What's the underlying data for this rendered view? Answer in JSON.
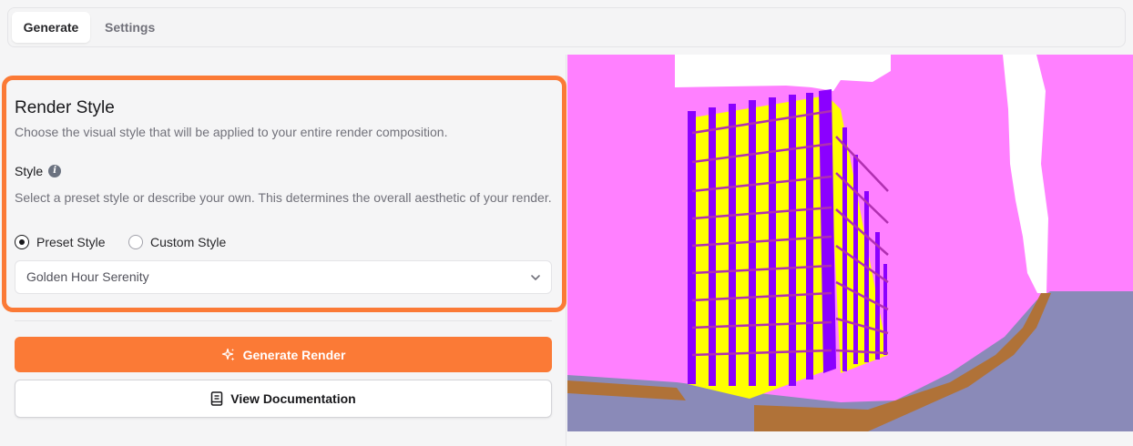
{
  "tabs": [
    {
      "label": "Generate",
      "active": true
    },
    {
      "label": "Settings",
      "active": false
    }
  ],
  "render_style": {
    "title": "Render Style",
    "description": "Choose the visual style that will be applied to your entire render composition.",
    "style_field": {
      "label": "Style",
      "help": "Select a preset style or describe your own. This determines the overall aesthetic of your render.",
      "options": [
        {
          "label": "Preset Style",
          "checked": true
        },
        {
          "label": "Custom Style",
          "checked": false
        }
      ],
      "selected_preset": "Golden Hour Serenity"
    }
  },
  "actions": {
    "generate_label": "Generate Render",
    "docs_label": "View Documentation"
  },
  "colors": {
    "accent": "#fb7a36",
    "seg_sky": "#ffffff",
    "seg_background": "#ff80ff",
    "seg_building_main": "#ffff00",
    "seg_building_frame": "#8b00ff",
    "seg_ground": "#8a8ab8",
    "seg_road": "#b07238"
  },
  "icons": {
    "info": "info-icon",
    "chevron": "chevron-down-icon",
    "sparkle": "sparkle-icon",
    "docs": "book-icon"
  }
}
